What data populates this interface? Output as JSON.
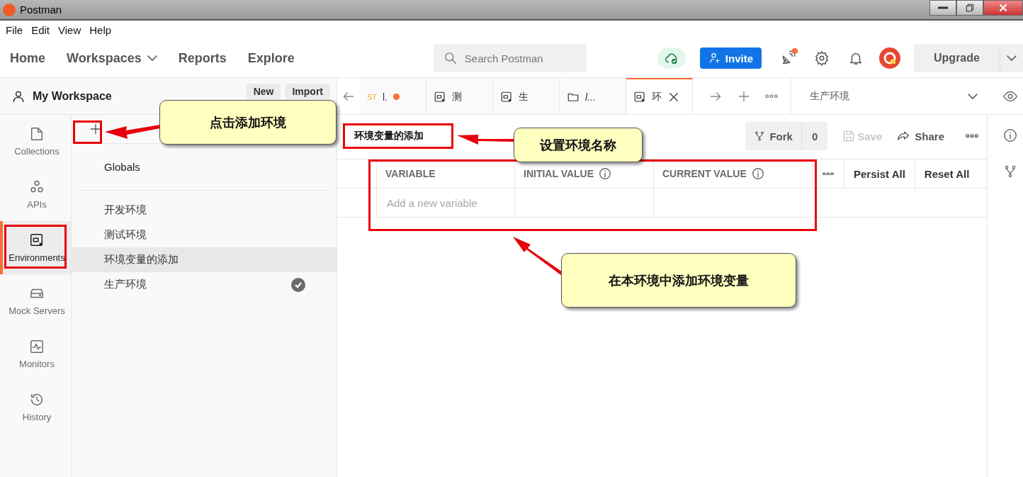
{
  "window": {
    "title": "Postman"
  },
  "menu": [
    "File",
    "Edit",
    "View",
    "Help"
  ],
  "nav": [
    {
      "label": "Home",
      "dropdown": false
    },
    {
      "label": "Workspaces",
      "dropdown": true
    },
    {
      "label": "Reports",
      "dropdown": false
    },
    {
      "label": "Explore",
      "dropdown": false
    }
  ],
  "search": {
    "placeholder": "Search Postman"
  },
  "invite": "Invite",
  "upgrade": "Upgrade",
  "workspace": {
    "name": "My Workspace",
    "buttons": [
      "New",
      "Import"
    ]
  },
  "rail": [
    {
      "label": "Collections",
      "selected": false
    },
    {
      "label": "APIs",
      "selected": false
    },
    {
      "label": "Environments",
      "selected": true
    },
    {
      "label": "Mock Servers",
      "selected": false
    },
    {
      "label": "Monitors",
      "selected": false
    },
    {
      "label": "History",
      "selected": false
    }
  ],
  "environments": {
    "globals": "Globals",
    "items": [
      {
        "name": "开发环境",
        "selected": false,
        "active": false
      },
      {
        "name": "测试环境",
        "selected": false,
        "active": false
      },
      {
        "name": "环境变量的添加",
        "selected": true,
        "active": false
      },
      {
        "name": "生产环境",
        "selected": false,
        "active": true
      }
    ]
  },
  "tabs": [
    {
      "kind": "request",
      "method": "ST",
      "label": "l.",
      "unsaved": true,
      "selected": false
    },
    {
      "kind": "environment",
      "label": "测",
      "unsaved": false,
      "selected": false
    },
    {
      "kind": "environment",
      "label": "生",
      "unsaved": false,
      "selected": false
    },
    {
      "kind": "folder",
      "label": "l...",
      "unsaved": false,
      "selected": false
    },
    {
      "kind": "environment",
      "label": "环",
      "unsaved": false,
      "selected": true
    }
  ],
  "env_select": "生产环境",
  "editor": {
    "name": "环境变量的添加",
    "fork": "Fork",
    "fork_count": "0",
    "save": "Save",
    "save_disabled": true,
    "share": "Share"
  },
  "table": {
    "columns": [
      {
        "label": "VARIABLE",
        "info": false
      },
      {
        "label": "INITIAL VALUE",
        "info": true
      },
      {
        "label": "CURRENT VALUE",
        "info": true
      }
    ],
    "placeholder": "Add a new variable",
    "actions": [
      "Persist All",
      "Reset All"
    ]
  },
  "annotations": [
    {
      "text": "点击添加环境"
    },
    {
      "text": "设置环境名称"
    },
    {
      "text": "在本环境中添加环境变量"
    }
  ]
}
